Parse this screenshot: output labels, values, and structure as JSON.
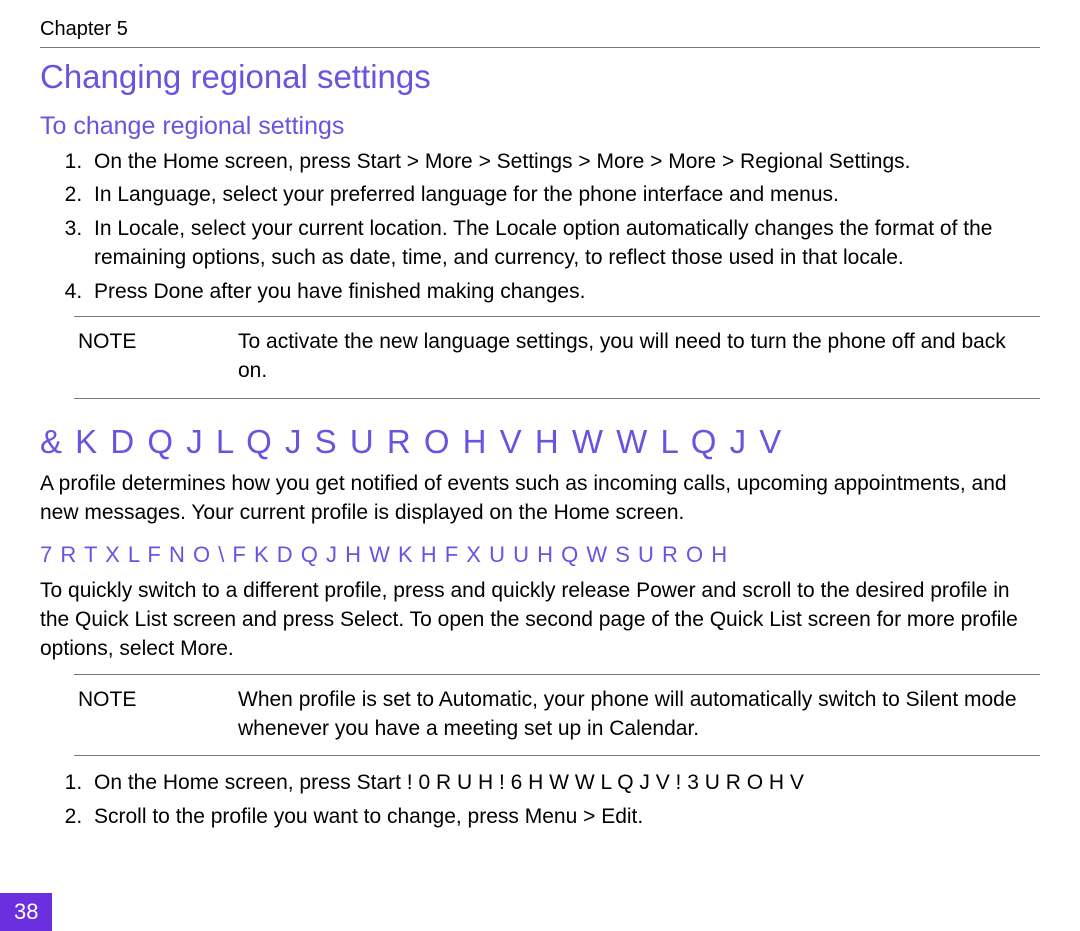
{
  "chapter_label": "Chapter 5",
  "h1": "Changing regional settings",
  "sec1": {
    "heading": "To change regional settings",
    "steps": [
      "On the Home screen, press Start  > More > Settings > More > More > Regional Settings.",
      "In Language, select your preferred language for the phone interface and menus.",
      "In Locale, select your current location. The Locale option automatically changes the format of the remaining options, such as date, time, and currency, to reflect those used in that locale.",
      "Press Done after you have finished making changes."
    ],
    "note_label": "NOTE",
    "note_text": "To activate the new language settings, you will need to turn the phone off and back on."
  },
  "sec2": {
    "heading": "& K D Q J L Q J   S U R   O H   V H W W L Q J V",
    "intro": "A profile determines how you get notified of events such as incoming calls, upcoming appointments, and new messages. Your current profile is displayed on the Home screen.",
    "sub_heading": "7 R   T X L F N O \\   F K D Q J H   W K H   F X U U H Q W   S U R   O H",
    "para2": "To quickly switch to a different profile, press and quickly release Power and scroll to the desired profile in the Quick List screen and press Select. To open the second page of the Quick List screen for more profile options, select More.",
    "note_label": "NOTE",
    "note_text": "When profile is set to Automatic, your phone will automatically switch to Silent mode whenever you have a meeting set up in Calendar.",
    "steps2": [
      "On the Home screen, press Start  !  0 R U H   !  6 H W W L Q J V  !  3 U R   O H V",
      "Scroll to the profile you want to change, press Menu > Edit."
    ]
  },
  "page_number": "38"
}
